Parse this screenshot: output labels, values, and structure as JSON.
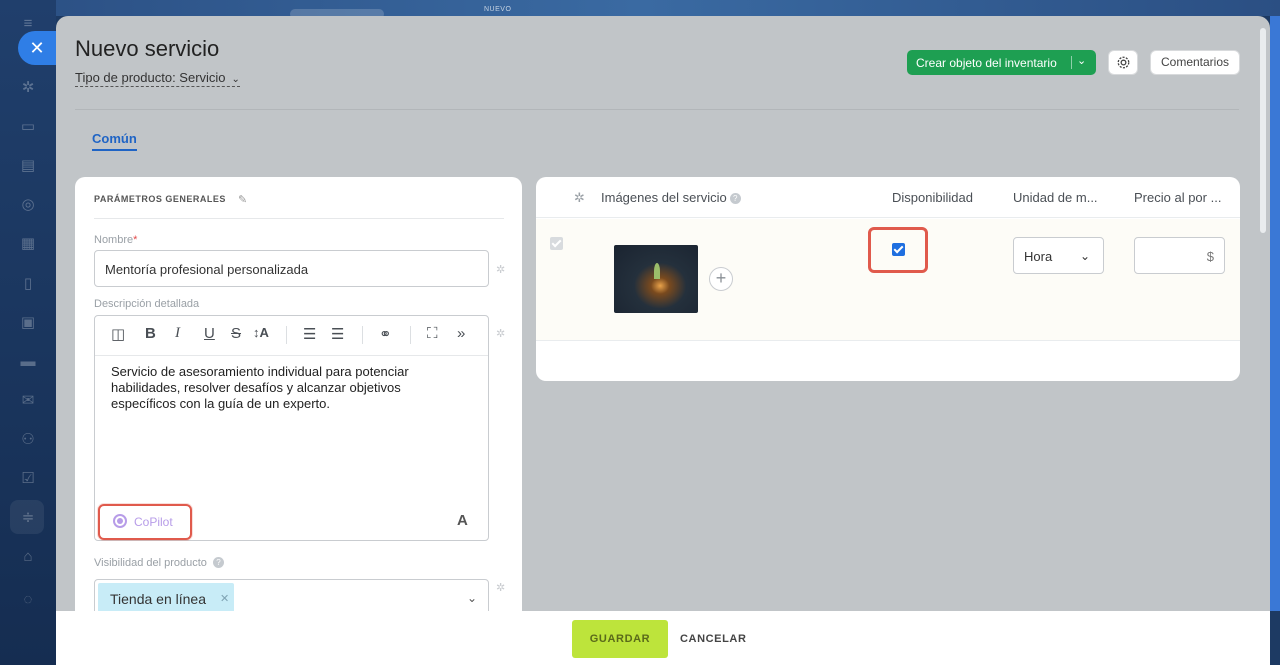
{
  "background": {
    "top_badge": "NUEVO",
    "nav_icons": [
      "menu-icon",
      "settings-icon",
      "chat-icon",
      "feed-icon",
      "target-icon",
      "calendar-icon",
      "document-icon",
      "board-icon",
      "card-icon",
      "mail-icon",
      "users-icon",
      "tasks-icon",
      "filter-icon",
      "inbox-icon",
      "globe-icon"
    ]
  },
  "header": {
    "title": "Nuevo servicio",
    "product_type": "Tipo de producto: Servicio",
    "create_inventory_label": "Crear objeto del inventario",
    "comments_label": "Comentarios"
  },
  "tabs": [
    {
      "label": "Común",
      "active": true
    }
  ],
  "general": {
    "section_title": "PARÁMETROS GENERALES",
    "name_label": "Nombre",
    "name_required": "*",
    "name_value": "Mentoría profesional personalizada",
    "description_label": "Descripción detallada",
    "description_text": "Servicio de asesoramiento individual para potenciar habilidades, resolver desafíos y alcanzar objetivos específicos con la guía de un experto.",
    "copilot_label": "CoPilot",
    "editor_font_button": "A",
    "visibility_label": "Visibilidad del producto",
    "visibility_tag": "Tienda en línea"
  },
  "editor_toolbar": {
    "bold": "B",
    "italic": "I",
    "underline": "U",
    "strike": "S",
    "font_size": "↕A"
  },
  "table": {
    "col_images": "Imágenes del servicio",
    "col_availability": "Disponibilidad",
    "col_unit": "Unidad de m...",
    "col_price": "Precio al por ...",
    "row": {
      "available": true,
      "unit": "Hora",
      "price_value": "",
      "currency": "$"
    }
  },
  "footer": {
    "save_label": "GUARDAR",
    "cancel_label": "CANCELAR"
  },
  "colors": {
    "accent": "#1f64c5",
    "success": "#1e9f52",
    "save": "#bde43b",
    "highlight": "#e05a4c"
  }
}
